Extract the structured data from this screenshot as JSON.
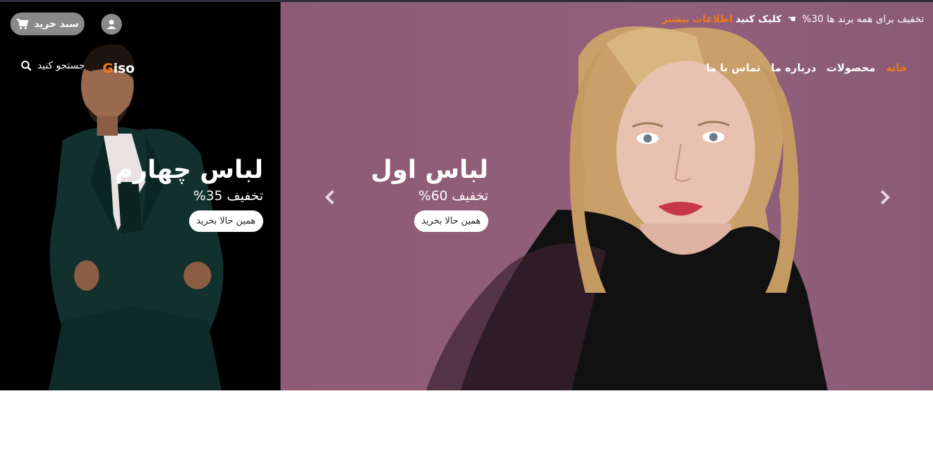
{
  "promo": {
    "text": "تخفیف برای همه برند ها 30%",
    "cta": "کلیک کنید",
    "more": "اطلاعات بیشتر"
  },
  "nav": {
    "items": [
      {
        "label": "خانه"
      },
      {
        "label": "محصولات"
      },
      {
        "label": "درباره ما"
      },
      {
        "label": "تماس با ما"
      }
    ]
  },
  "header": {
    "cart_label": "سبد خرید",
    "logo_first": "G",
    "logo_rest": "iso",
    "search_label": "جستجو کنید"
  },
  "slides": [
    {
      "title": "لباس اول",
      "discount": "تخفیف 60%",
      "button": "همین حالا بخرید"
    },
    {
      "title": "لباس چهارم",
      "discount": "تخفیف 35%",
      "button": "همین حالا بخرید"
    }
  ],
  "colors": {
    "accent": "#f07a1a",
    "hero_bg": "#8e5b76",
    "left_bg": "#000000",
    "pill_bg": "#8a8a8a"
  },
  "icons": {
    "cart": "cart-icon",
    "user": "user-icon",
    "search": "search-icon",
    "hand": "hand-pointing-icon",
    "prev": "chevron-left-icon",
    "next": "chevron-right-icon"
  }
}
